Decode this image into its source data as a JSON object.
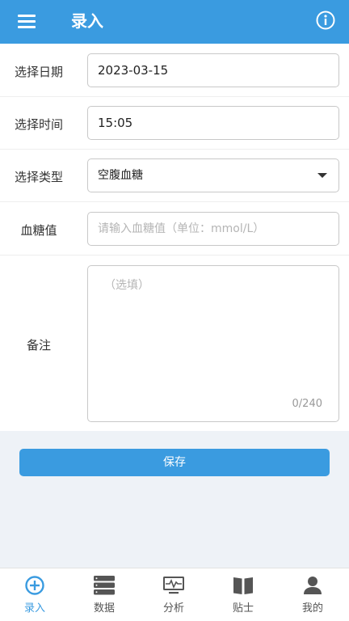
{
  "header": {
    "title": "录入",
    "menu_icon": "menu-icon",
    "info_icon": "info-icon"
  },
  "form": {
    "date": {
      "label": "选择日期",
      "value": "2023-03-15"
    },
    "time": {
      "label": "选择时间",
      "value": "15:05"
    },
    "type": {
      "label": "选择类型",
      "value": "空腹血糖"
    },
    "glucose": {
      "label": "血糖值",
      "placeholder": "请输入血糖值（单位：mmol/L）"
    },
    "note": {
      "label": "备注",
      "placeholder": "（选填）",
      "counter": "0/240"
    }
  },
  "save_button": {
    "label": "保存"
  },
  "tabs": [
    {
      "label": "录入",
      "icon": "plus-circle-icon",
      "active": true
    },
    {
      "label": "数据",
      "icon": "database-icon",
      "active": false
    },
    {
      "label": "分析",
      "icon": "monitor-chart-icon",
      "active": false
    },
    {
      "label": "贴士",
      "icon": "book-icon",
      "active": false
    },
    {
      "label": "我的",
      "icon": "person-icon",
      "active": false
    }
  ],
  "colors": {
    "primary": "#3a9be0",
    "background": "#eef2f7",
    "border": "#c8c8c8"
  }
}
